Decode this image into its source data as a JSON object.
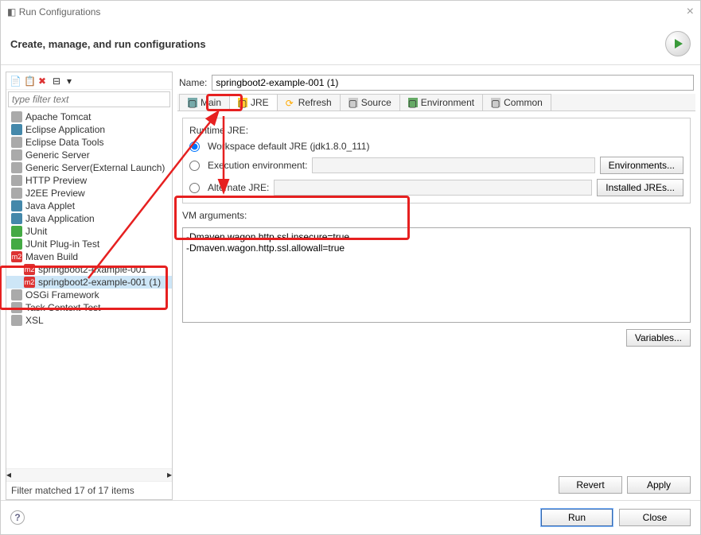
{
  "window": {
    "title": "Run Configurations",
    "subtitle": "Create, manage, and run configurations"
  },
  "filter": {
    "placeholder": "type filter text",
    "status": "Filter matched 17 of 17 items"
  },
  "tree": [
    {
      "label": "Apache Tomcat",
      "iconCls": "grey"
    },
    {
      "label": "Eclipse Application",
      "iconCls": "java"
    },
    {
      "label": "Eclipse Data Tools",
      "iconCls": "grey"
    },
    {
      "label": "Generic Server",
      "iconCls": "grey"
    },
    {
      "label": "Generic Server(External Launch)",
      "iconCls": "grey"
    },
    {
      "label": "HTTP Preview",
      "iconCls": "grey"
    },
    {
      "label": "J2EE Preview",
      "iconCls": "grey"
    },
    {
      "label": "Java Applet",
      "iconCls": "java"
    },
    {
      "label": "Java Application",
      "iconCls": "java"
    },
    {
      "label": "JUnit",
      "iconCls": "ju"
    },
    {
      "label": "JUnit Plug-in Test",
      "iconCls": "ju"
    },
    {
      "label": "Maven Build",
      "iconCls": "m2",
      "expanded": true
    },
    {
      "label": "springboot2-example-001",
      "iconCls": "m2",
      "child": true
    },
    {
      "label": "springboot2-example-001 (1)",
      "iconCls": "m2",
      "child": true,
      "selected": true
    },
    {
      "label": "OSGi Framework",
      "iconCls": "grey"
    },
    {
      "label": "Task Context Test",
      "iconCls": "grey"
    },
    {
      "label": "XSL",
      "iconCls": "grey"
    }
  ],
  "name": {
    "label": "Name:",
    "value": "springboot2-example-001 (1)"
  },
  "tabs": {
    "main": "Main",
    "jre": "JRE",
    "refresh": "Refresh",
    "source": "Source",
    "environment": "Environment",
    "common": "Common"
  },
  "jre": {
    "group_label": "Runtime JRE:",
    "workspace_default": "Workspace default JRE (jdk1.8.0_111)",
    "exec_env": "Execution environment:",
    "alternate": "Alternate JRE:",
    "env_btn": "Environments...",
    "installed_btn": "Installed JREs...",
    "vm_label": "VM arguments:",
    "vm_value": "-Dmaven.wagon.http.ssl.insecure=true\n-Dmaven.wagon.http.ssl.allowall=true",
    "variables_btn": "Variables..."
  },
  "buttons": {
    "revert": "Revert",
    "apply": "Apply",
    "run": "Run",
    "close": "Close"
  }
}
